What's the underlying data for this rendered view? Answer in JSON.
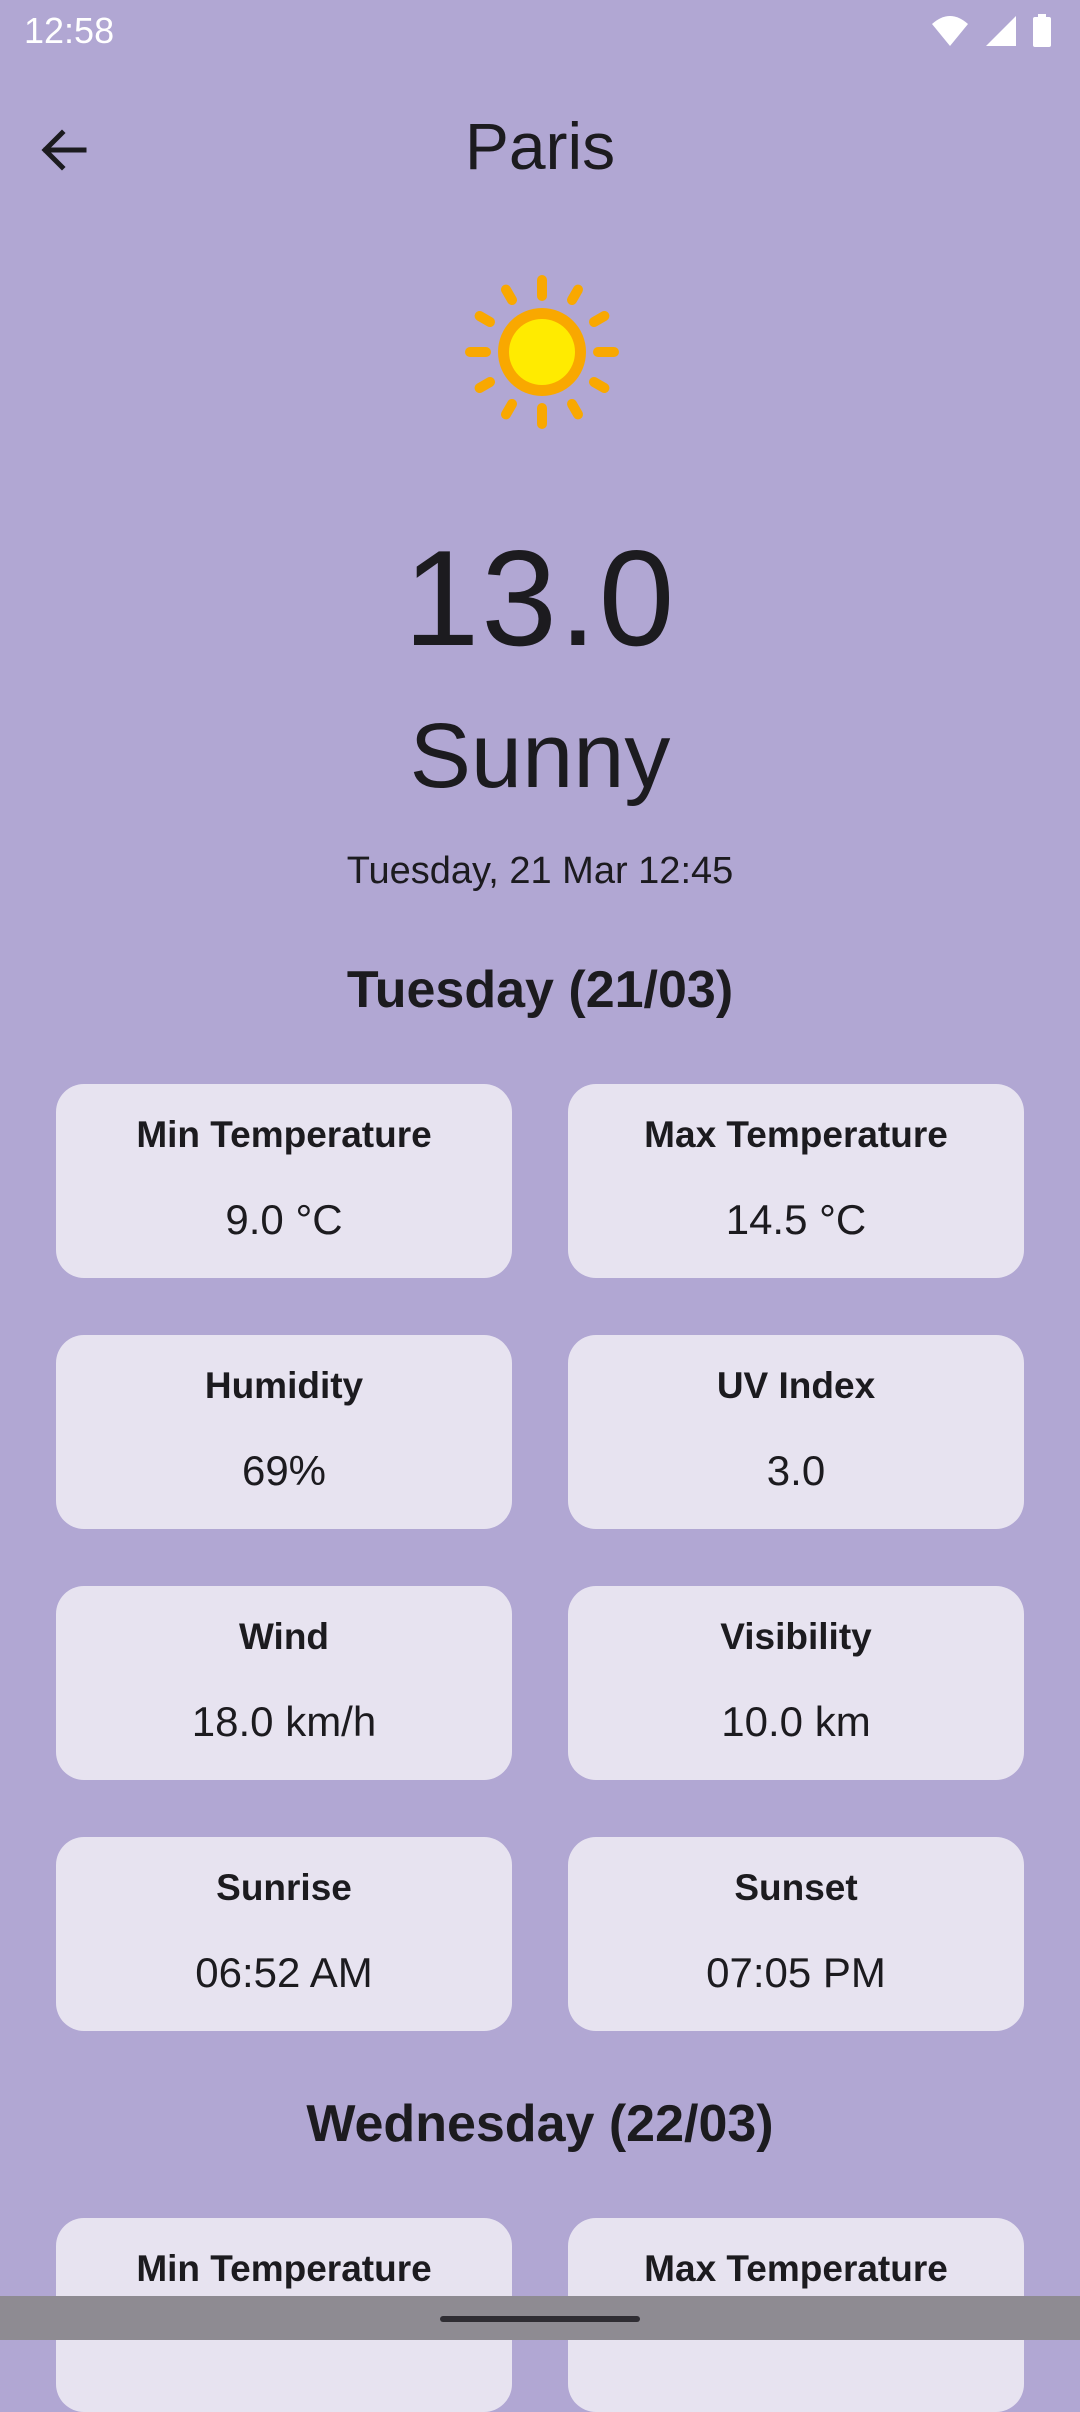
{
  "status_bar": {
    "time": "12:58",
    "icons": [
      "wifi-icon",
      "signal-icon",
      "battery-icon"
    ]
  },
  "header": {
    "back_icon": "arrow-left-icon",
    "title": "Paris"
  },
  "current": {
    "icon": "sun-icon",
    "temperature": "13.0",
    "condition": "Sunny",
    "datetime": "Tuesday, 21 Mar 12:45"
  },
  "days": [
    {
      "heading": "Tuesday (21/03)",
      "cards": [
        {
          "label": "Min Temperature",
          "value": "9.0 °C"
        },
        {
          "label": "Max Temperature",
          "value": "14.5 °C"
        },
        {
          "label": "Humidity",
          "value": "69%"
        },
        {
          "label": "UV Index",
          "value": "3.0"
        },
        {
          "label": "Wind",
          "value": "18.0 km/h"
        },
        {
          "label": "Visibility",
          "value": "10.0 km"
        },
        {
          "label": "Sunrise",
          "value": "06:52 AM"
        },
        {
          "label": "Sunset",
          "value": "07:05 PM"
        }
      ]
    },
    {
      "heading": "Wednesday (22/03)",
      "cards": [
        {
          "label": "Min Temperature"
        },
        {
          "label": "Max Temperature"
        }
      ]
    }
  ],
  "colors": {
    "background": "#b1a7d3",
    "card": "#e7e3f0",
    "text": "#1c1b1f",
    "sun_core": "#ffeb00",
    "sun_ring": "#f9a800"
  }
}
